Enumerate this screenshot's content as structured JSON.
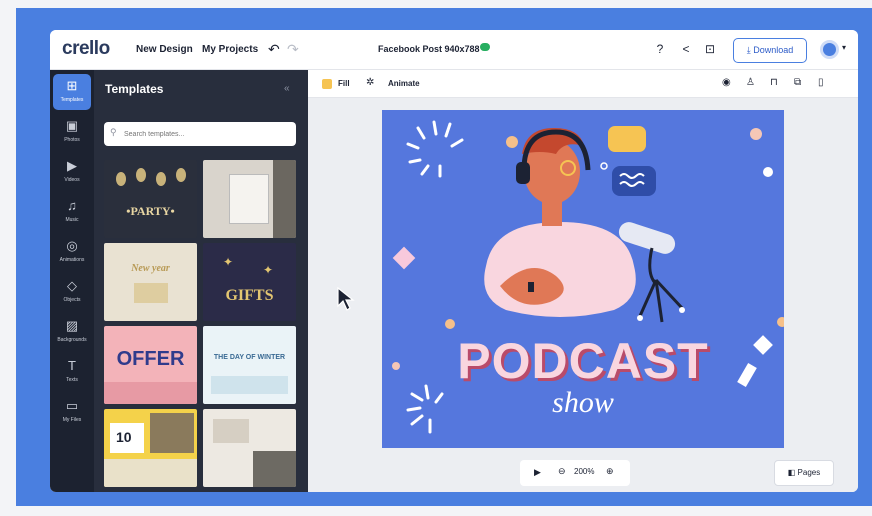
{
  "app": {
    "logo": "crello",
    "nav": [
      "New Design",
      "My Projects"
    ],
    "document_title": "Facebook Post 940x788",
    "download_label": "Download"
  },
  "rail": [
    {
      "label": "Templates",
      "icon": "templates-icon"
    },
    {
      "label": "Photos",
      "icon": "photos-icon"
    },
    {
      "label": "Videos",
      "icon": "videos-icon"
    },
    {
      "label": "Music",
      "icon": "music-icon"
    },
    {
      "label": "Animations",
      "icon": "animations-icon"
    },
    {
      "label": "Objects",
      "icon": "objects-icon"
    },
    {
      "label": "Backgrounds",
      "icon": "backgrounds-icon"
    },
    {
      "label": "Texts",
      "icon": "texts-icon"
    },
    {
      "label": "My Files",
      "icon": "my-files-icon"
    }
  ],
  "panel": {
    "title": "Templates",
    "collapse": "«",
    "search_placeholder": "Search templates...",
    "thumbs": [
      {
        "text": "•PARTY•",
        "bg": "#2a2f3c",
        "fg": "#e8d6a3"
      },
      {
        "text": "",
        "bg": "#d9d4cc",
        "fg": "#333"
      },
      {
        "text": "New year",
        "bg": "#e9e2d2",
        "fg": "#b89a55"
      },
      {
        "text": "GIFTS",
        "bg": "#2b2b48",
        "fg": "#e3c671"
      },
      {
        "text": "OFFER",
        "bg": "#f3b3b9",
        "fg": "#2f3b8c"
      },
      {
        "text": "THE DAY OF WINTER",
        "bg": "#eaf3f7",
        "fg": "#3a6a94"
      },
      {
        "text": "10",
        "bg": "#f4d24a",
        "fg": "#1c2233"
      },
      {
        "text": "",
        "bg": "#ede9e2",
        "fg": "#555"
      }
    ]
  },
  "toolbar": {
    "fill_label": "Fill",
    "animate_label": "Animate"
  },
  "design": {
    "headline": "PODCAST",
    "subline": "show",
    "bg_color": "#5577dd"
  },
  "zoom": {
    "value": "200%"
  },
  "pages_label": "Pages"
}
